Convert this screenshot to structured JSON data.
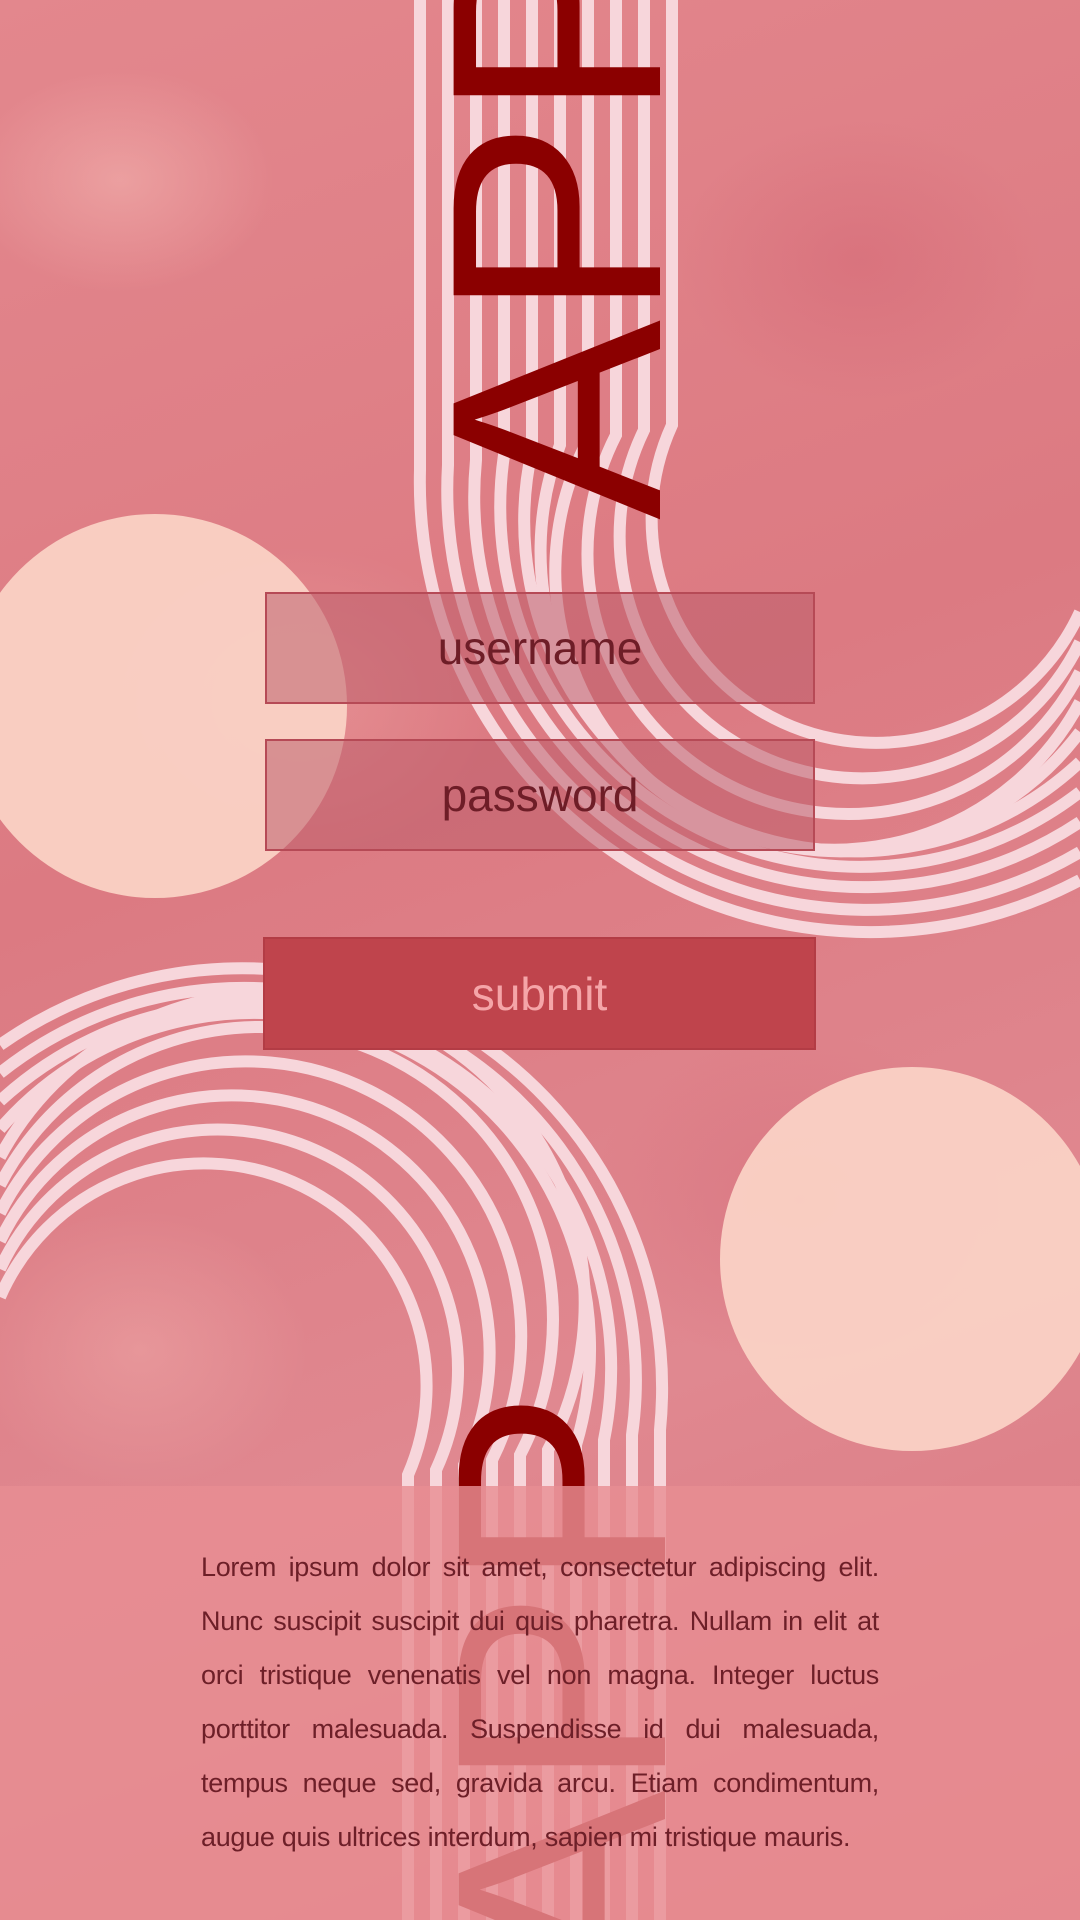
{
  "form": {
    "username_placeholder": "username",
    "password_placeholder": "password",
    "submit_label": "submit"
  },
  "decor": {
    "top_word": "APP",
    "bottom_word": "APP"
  },
  "footer": {
    "body_text": "Lorem ipsum dolor sit amet, consectetur adipiscing elit. Nunc suscipit suscipit dui quis pharetra. Nullam in elit at orci tristique venenatis vel non magna. Integer luctus porttitor malesuada. Suspendisse id dui malesuada, tempus neque sed, gravida arcu. Etiam condimentum, augue quis ultrices interdum, sapien mi tristique mauris."
  },
  "colors": {
    "background": "#e07f86",
    "accent_dark_red": "#8b0000",
    "stripe": "#f8d6dc",
    "circle": "#fbd3c6",
    "button": "#bf444c"
  }
}
